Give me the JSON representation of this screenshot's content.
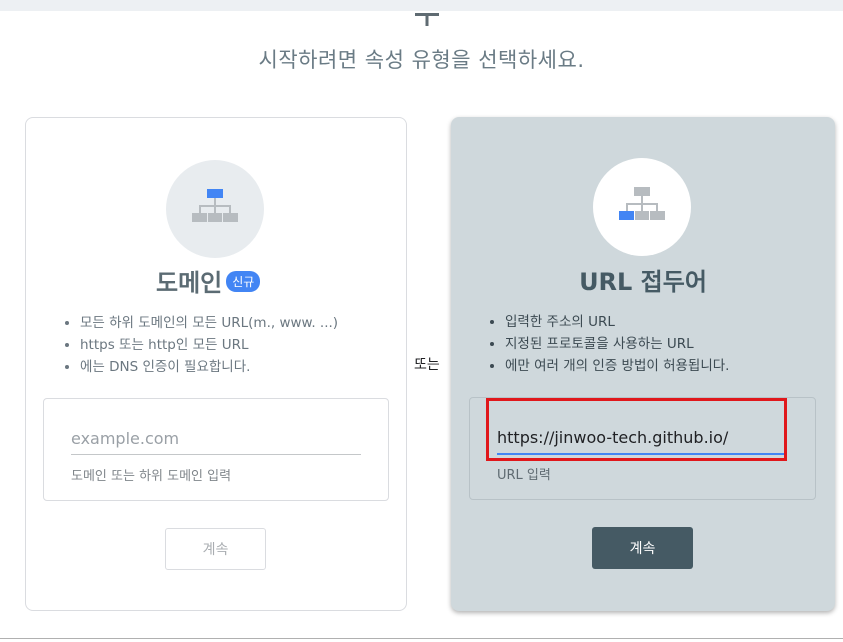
{
  "page": {
    "subtitle": "시작하려면 속성 유형을 선택하세요.",
    "or_label": "또는"
  },
  "domain_card": {
    "icon": "sitemap-icon",
    "title": "도메인",
    "badge": "신규",
    "bullets": [
      "모든 하위 도메인의 모든 URL(m., www. ...)",
      "https 또는 http인 모든 URL",
      "에는 DNS 인증이 필요합니다."
    ],
    "input_placeholder": "example.com",
    "input_value": "",
    "input_help": "도메인 또는 하위 도메인 입력",
    "button_label": "계속",
    "button_enabled": false
  },
  "url_card": {
    "icon": "sitemap-icon",
    "title": "URL 접두어",
    "bullets": [
      "입력한 주소의 URL",
      "지정된 프로토콜을 사용하는 URL",
      "에만 여러 개의 인증 방법이 허용됩니다."
    ],
    "input_value": "https://jinwoo-tech.github.io/",
    "input_help": "URL 입력",
    "button_label": "계속",
    "button_enabled": true,
    "selected": true
  },
  "colors": {
    "accent_blue": "#4285f4",
    "selected_card_bg": "#cfd8dc",
    "primary_button": "#455a64",
    "highlight_red": "#e0171b"
  }
}
